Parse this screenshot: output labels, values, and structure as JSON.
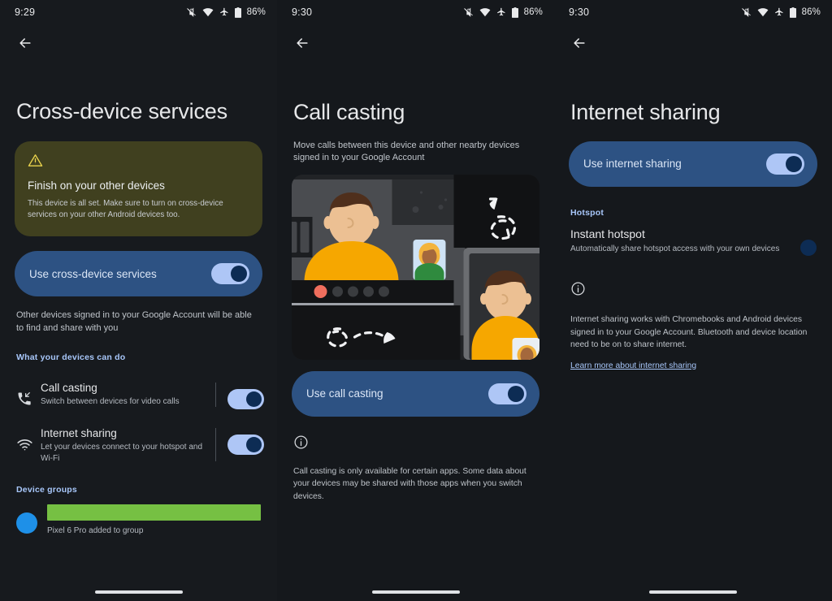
{
  "panels": [
    {
      "status": {
        "time": "9:29",
        "battery": "86%",
        "icons": [
          "mute-icon",
          "wifi-icon",
          "airplane-mode-icon",
          "battery-icon"
        ]
      },
      "back_label": "Back",
      "title": "Cross-device services",
      "warning": {
        "icon": "warning-triangle-icon",
        "title": "Finish on your other devices",
        "body": "This device is all set. Make sure to turn on cross-device services on your other Android devices too."
      },
      "main_toggle": {
        "label": "Use cross-device services",
        "on": true
      },
      "footnote": "Other devices signed in to your Google Account will be able to find and share with you",
      "features_label": "What your devices can do",
      "features": [
        {
          "icon": "call-casting-icon",
          "title": "Call casting",
          "sub": "Switch between devices for video calls",
          "on": true
        },
        {
          "icon": "wifi-icon",
          "title": "Internet sharing",
          "sub": "Let your devices connect to your hotspot and Wi-Fi",
          "on": true
        }
      ],
      "device_groups_label": "Device groups",
      "device_group": {
        "name_redacted": "",
        "sub": "Pixel 6 Pro added to group"
      }
    },
    {
      "status": {
        "time": "9:30",
        "battery": "86%"
      },
      "title": "Call casting",
      "description": "Move calls between this device and other nearby devices signed in to your Google Account",
      "illustration": "call-casting-illustration",
      "main_toggle": {
        "label": "Use call casting",
        "on": true
      },
      "info_icon": "info-icon",
      "note": "Call casting is only available for certain apps. Some data about your devices may be shared with those apps when you switch devices."
    },
    {
      "status": {
        "time": "9:30",
        "battery": "86%"
      },
      "title": "Internet sharing",
      "main_toggle": {
        "label": "Use internet sharing",
        "on": true
      },
      "hotspot_label": "Hotspot",
      "hotspot": {
        "title": "Instant hotspot",
        "sub": "Automatically share hotspot access with your own devices",
        "on": true
      },
      "info_icon": "info-icon",
      "note": "Internet sharing works with Chromebooks and Android devices signed in to your Google Account. Bluetooth and device location need to be on to share internet.",
      "learn_more": "Learn more about internet sharing"
    }
  ],
  "colors": {
    "background": "#171a1e",
    "blue_card": "#2d5283",
    "warning_card": "#40401f",
    "switch_track": "#aec6f6",
    "switch_thumb": "#0d2c54",
    "accent_link": "#a8c7fa",
    "redaction_green": "#76c043",
    "avatar_blue": "#1e90e8"
  }
}
